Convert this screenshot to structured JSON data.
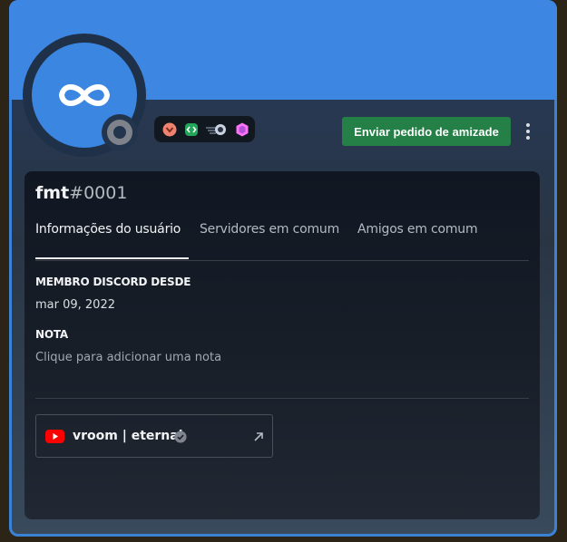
{
  "profile": {
    "username": "fmt",
    "discriminator": "#0001",
    "status": "offline",
    "avatar_icon": "infinity-icon",
    "badges": [
      "hypesquad-bravery-badge",
      "active-developer-badge",
      "quest-badge",
      "nitro-boost-badge"
    ]
  },
  "actions": {
    "add_friend_label": "Enviar pedido de amizade",
    "more_icon": "more-vertical-icon"
  },
  "tabs": [
    {
      "label": "Informações do usuário",
      "active": true
    },
    {
      "label": "Servidores em comum",
      "active": false
    },
    {
      "label": "Amigos em comum",
      "active": false
    }
  ],
  "member_since": {
    "title": "MEMBRO DISCORD DESDE",
    "value": "mar 09, 2022"
  },
  "note": {
    "title": "NOTA",
    "placeholder": "Clique para adicionar uma nota"
  },
  "connections": [
    {
      "platform": "youtube",
      "name": "vroom | eternal",
      "verified": true
    }
  ],
  "colors": {
    "banner": "#3d87e2",
    "button": "#248046",
    "youtube": "#ff0000"
  }
}
